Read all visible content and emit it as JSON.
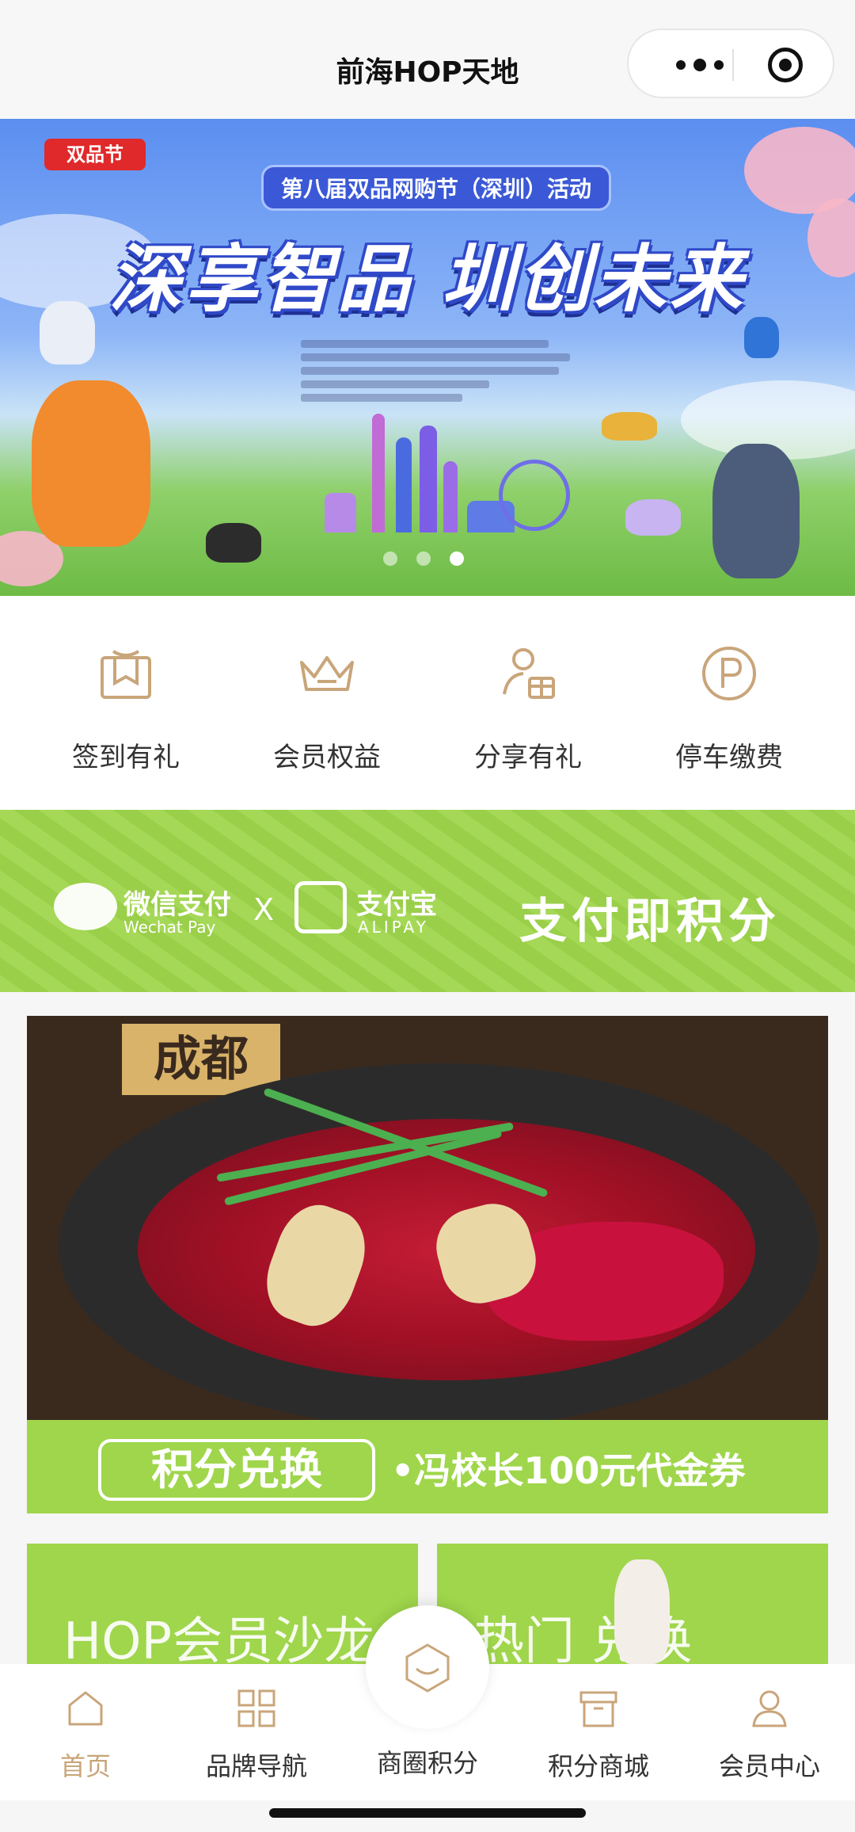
{
  "header": {
    "title": "前海HOP天地"
  },
  "banner": {
    "badge": "双品节",
    "subtitle": "第八届双品网购节（深圳）活动",
    "title": "深享智品 圳创未来",
    "active_dot": 3,
    "dot_count": 3
  },
  "quick_menu": [
    {
      "label": "签到有礼",
      "icon": "gift-box-icon"
    },
    {
      "label": "会员权益",
      "icon": "crown-icon"
    },
    {
      "label": "分享有礼",
      "icon": "user-gift-icon"
    },
    {
      "label": "停车缴费",
      "icon": "parking-icon"
    }
  ],
  "pay_banner": {
    "wechat": "微信支付",
    "wechat_en": "Wechat Pay",
    "times": "X",
    "alipay": "支付宝",
    "alipay_en": "ALIPAY",
    "slogan": "支付即积分"
  },
  "food_promo": {
    "sign": "成都",
    "tag": "积分兑换",
    "desc": "•冯校长100元代金券"
  },
  "tiles": [
    {
      "text": "HOP会员沙龙"
    },
    {
      "text": "热门  兑换"
    }
  ],
  "tabbar": [
    {
      "label": "首页",
      "icon": "home-icon",
      "active": true
    },
    {
      "label": "品牌导航",
      "icon": "grid-icon",
      "active": false
    },
    {
      "label": "商圈积分",
      "icon": "hexagon-icon",
      "active": false
    },
    {
      "label": "积分商城",
      "icon": "store-box-icon",
      "active": false
    },
    {
      "label": "会员中心",
      "icon": "user-icon",
      "active": false
    }
  ],
  "colors": {
    "accent": "#c9a57a",
    "green": "#9fd64b",
    "icon": "#c9a57a"
  }
}
